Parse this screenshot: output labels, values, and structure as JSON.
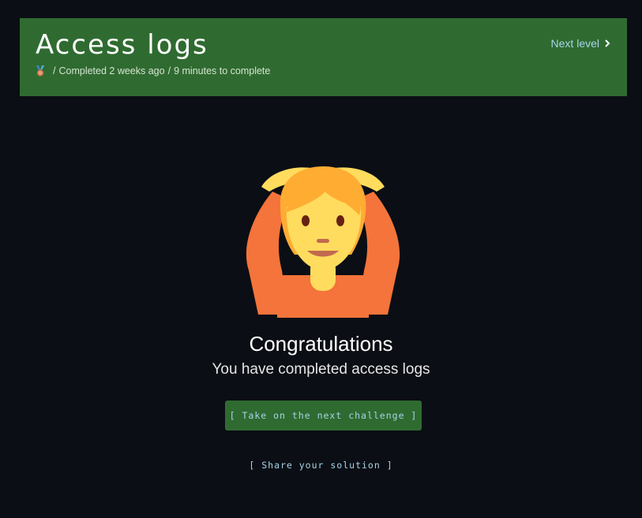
{
  "header": {
    "title": "Access logs",
    "medal_icon": "medal-icon",
    "separator": "/",
    "completed_text": "Completed 2 weeks ago",
    "duration_text": "9 minutes to complete",
    "next_level_label": "Next level",
    "chevron_icon": "chevron-right-icon"
  },
  "main": {
    "emoji_icon": "person-gesturing-ok-emoji",
    "heading": "Congratulations",
    "subheading": "You have completed access logs",
    "next_challenge_button": "[ Take on the next challenge ]",
    "share_link": "[ Share your solution ]"
  },
  "colors": {
    "background": "#0b0e14",
    "header_bg": "#2f6b30",
    "link": "#a9d3ea",
    "text": "#ffffff"
  }
}
